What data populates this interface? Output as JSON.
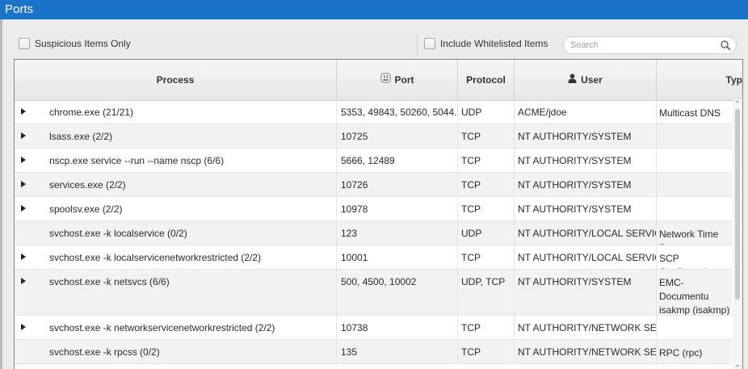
{
  "window": {
    "title": "Ports"
  },
  "toolbar": {
    "suspicious_label": "Suspicious Items Only",
    "whitelisted_label": "Include Whitelisted Items",
    "search_placeholder": "Search"
  },
  "columns": {
    "process": "Process",
    "port": "Port",
    "protocol": "Protocol",
    "user": "User",
    "type": "Typ"
  },
  "rows": [
    {
      "process": "chrome.exe  (21/21)",
      "port": "5353, 49843, 50260, 5044...",
      "protocol": "UDP",
      "user": "ACME/jdoe",
      "type": "Multicast DNS (m",
      "expandable": true
    },
    {
      "process": "lsass.exe  (2/2)",
      "port": "10725",
      "protocol": "TCP",
      "user": "NT AUTHORITY/SYSTEM",
      "type": "",
      "expandable": true
    },
    {
      "process": "nscp.exe service --run --name nscp (6/6)",
      "port": "5666, 12489",
      "protocol": "TCP",
      "user": "NT AUTHORITY/SYSTEM",
      "type": "",
      "expandable": true
    },
    {
      "process": "services.exe  (2/2)",
      "port": "10726",
      "protocol": "TCP",
      "user": "NT AUTHORITY/SYSTEM",
      "type": "",
      "expandable": true
    },
    {
      "process": "spoolsv.exe  (2/2)",
      "port": "10978",
      "protocol": "TCP",
      "user": "NT AUTHORITY/SYSTEM",
      "type": "",
      "expandable": true
    },
    {
      "process": "svchost.exe -k localservice (0/2)",
      "port": "123",
      "protocol": "UDP",
      "user": "NT AUTHORITY/LOCAL SERVICE",
      "type": "Network Time Pro",
      "expandable": false
    },
    {
      "process": "svchost.exe -k localservicenetworkrestricted (2/2)",
      "port": "10001",
      "protocol": "TCP",
      "user": "NT AUTHORITY/LOCAL SERVICE",
      "type": "SCP Configuratio",
      "expandable": true
    },
    {
      "process": "svchost.exe -k netsvcs (6/6)",
      "port": "500, 4500, 10002",
      "protocol": "UDP, TCP",
      "user": "NT AUTHORITY/SYSTEM",
      "type": "EMC-Documentu\nisakmp (isakmp)\nIPsec NAT-Traver",
      "expandable": true
    },
    {
      "process": "svchost.exe -k networkservicenetworkrestricted (2/2)",
      "port": "10738",
      "protocol": "TCP",
      "user": "NT AUTHORITY/NETWORK SE...",
      "type": "",
      "expandable": true
    },
    {
      "process": "svchost.exe -k rpcss (0/2)",
      "port": "135",
      "protocol": "TCP",
      "user": "NT AUTHORITY/NETWORK SE...",
      "type": "RPC (rpc)",
      "expandable": false
    }
  ],
  "colors": {
    "titlebar": "#1a73c9",
    "focus_border": "#3a9ad9"
  }
}
